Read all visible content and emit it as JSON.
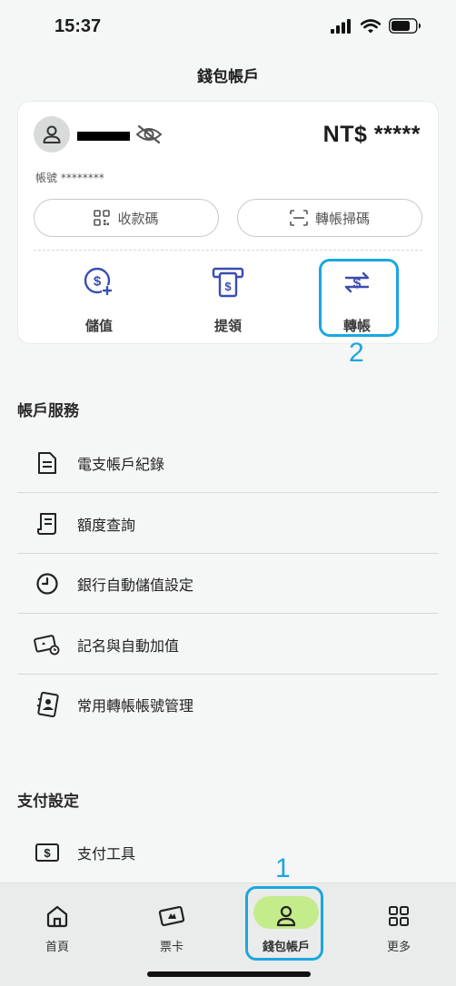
{
  "status_bar": {
    "time": "15:37"
  },
  "header": {
    "title": "錢包帳戶"
  },
  "wallet": {
    "balance": "NT$ *****",
    "account_label": "帳號 ********",
    "pay_code_label": "收款碼",
    "scan_label": "轉帳掃碼",
    "actions": [
      {
        "label": "儲值",
        "icon": "deposit-icon"
      },
      {
        "label": "提領",
        "icon": "withdraw-icon"
      },
      {
        "label": "轉帳",
        "icon": "transfer-icon"
      }
    ]
  },
  "account_services": {
    "title": "帳戶服務",
    "items": [
      {
        "label": "電支帳戶紀錄",
        "icon": "document-icon"
      },
      {
        "label": "額度查詢",
        "icon": "receipt-icon"
      },
      {
        "label": "銀行自動儲值設定",
        "icon": "clock-icon"
      },
      {
        "label": "記名與自動加值",
        "icon": "card-icon"
      },
      {
        "label": "常用轉帳帳號管理",
        "icon": "contact-book-icon"
      }
    ]
  },
  "payment_settings": {
    "title": "支付設定",
    "items": [
      {
        "label": "支付工具",
        "icon": "dollar-card-icon"
      }
    ]
  },
  "tab_bar": {
    "items": [
      {
        "label": "首頁",
        "icon": "home-icon"
      },
      {
        "label": "票卡",
        "icon": "ticket-card-icon"
      },
      {
        "label": "錢包帳戶",
        "icon": "user-icon",
        "active": true
      },
      {
        "label": "更多",
        "icon": "grid-icon"
      }
    ]
  },
  "annotations": {
    "callout_1": "1",
    "callout_2": "2"
  },
  "colors": {
    "accent": "#3a4db0",
    "highlight": "#1aa7e0",
    "active_tab": "#c5ec8b"
  }
}
